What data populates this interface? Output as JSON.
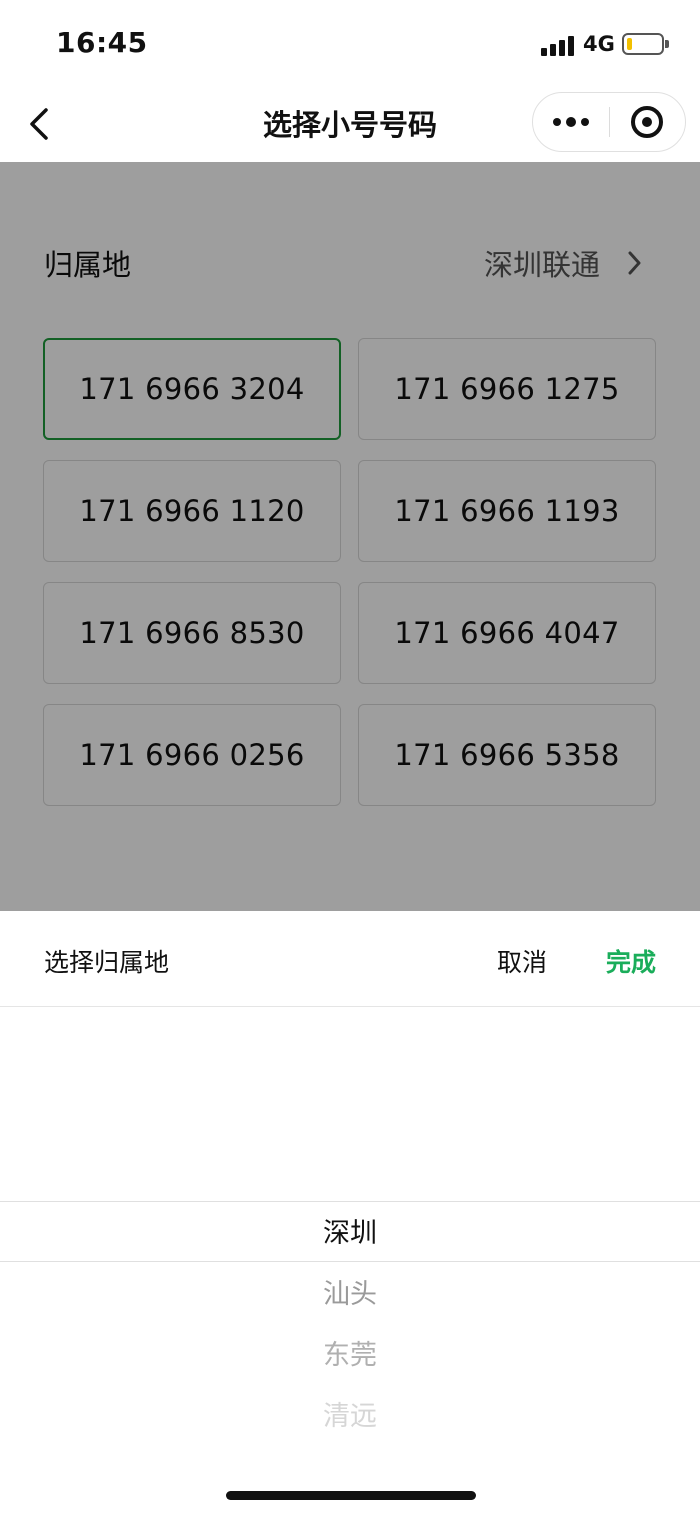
{
  "status_bar": {
    "time": "16:45",
    "network": "4G",
    "battery_level": 0.15
  },
  "nav": {
    "title": "选择小号号码",
    "back_icon": "chevron-left-icon",
    "more_icon": "more-dots-icon",
    "close_icon": "target-circle-icon"
  },
  "location": {
    "label": "归属地",
    "value": "深圳联通"
  },
  "numbers": [
    {
      "value": "171 6966 3204",
      "selected": true
    },
    {
      "value": "171 6966 1275",
      "selected": false
    },
    {
      "value": "171 6966 1120",
      "selected": false
    },
    {
      "value": "171 6966 1193",
      "selected": false
    },
    {
      "value": "171 6966 8530",
      "selected": false
    },
    {
      "value": "171 6966 4047",
      "selected": false
    },
    {
      "value": "171 6966 0256",
      "selected": false
    },
    {
      "value": "171 6966 5358",
      "selected": false
    }
  ],
  "picker": {
    "title": "选择归属地",
    "cancel_label": "取消",
    "done_label": "完成",
    "options": [
      "深圳",
      "汕头",
      "东莞",
      "清远"
    ],
    "selected_option": "深圳"
  },
  "colors": {
    "accent": "#1aad5a",
    "selected_border": "#1f9c3d",
    "battery": "#f2c000"
  }
}
